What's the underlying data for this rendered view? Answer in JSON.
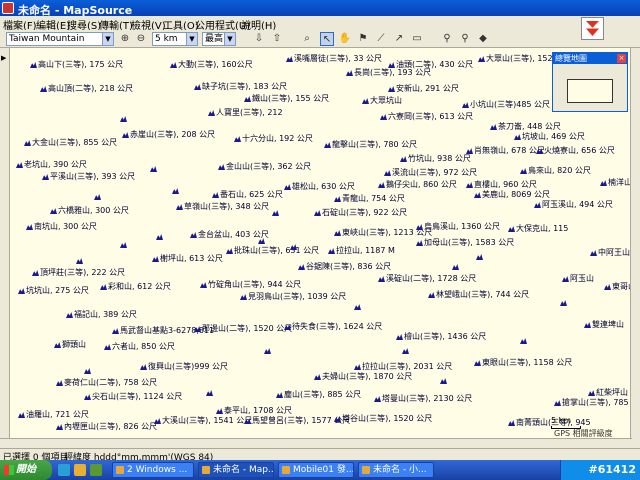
{
  "window": {
    "title": "未命名 - MapSource"
  },
  "menu": [
    "檔案(F)",
    "編輯(E)",
    "搜尋(S)",
    "傳輸(T)",
    "檢視(V)",
    "工具(O)",
    "公用程式(U)",
    "說明(H)"
  ],
  "toolbar": {
    "map_product": "Taiwan Mountain",
    "zoom_scale": "5 km",
    "detail_level": "最高"
  },
  "overview": {
    "title": "總覽地圖"
  },
  "scale": {
    "label": "5 km"
  },
  "gps_note": "GPS 相關評級度",
  "status": {
    "selection": "已選擇 0 個項目",
    "coord_format": "經緯度 hddd°mm.mmm'(WGS 84)"
  },
  "taskbar": {
    "start": "開始",
    "tasks": [
      "2 Windows ...",
      "未命名 - Map...",
      "Mobile01 發...",
      "未命名 - 小..."
    ],
    "clock": "#61412"
  },
  "peaks": [
    "高山下(三等), 175 公尺",
    "大動(三等), 160公尺",
    "溪嘴層徒(三等), 33 公尺",
    "油頭(二等), 430 公尺",
    "大眾山(三等), 152",
    "高山頂(二等), 218 公尺",
    "缺子坑(三等), 183 公尺",
    "長崗(三等), 193 公尺",
    "安新山, 291 公尺",
    "鐵山(三等), 155 公尺",
    "大眾坑山",
    "小坑山(三等)485 公尺",
    "人寶里(三等), 212",
    "六寮岡(三等), 613 公尺",
    "茶刀崙, 448 公尺",
    "赤崖山(三等), 208 公尺",
    "十六分山, 192 公尺",
    "坑坡山, 469 公尺",
    "大金山(三等), 855 公尺",
    "龍擊山(三等), 780 公尺",
    "肖無嶺山, 678 公尺",
    "火燒寮山, 656 公尺",
    "老坑山, 390 公尺",
    "金山山(三等), 362 公尺",
    "竹坑山, 938 公尺",
    "鳥來山, 820 公尺",
    "平溪山(三等), 393 公尺",
    "溪流山(三等), 972 公尺",
    "楠洋山",
    "雄松山, 630 公尺",
    "鵝仔尖山, 860 公尺",
    "直樓山, 960 公尺",
    "番石山, 625 公尺",
    "青龍山, 754 公尺",
    "美鹿山, 8069 公尺",
    "六橋雅山, 300 公尺",
    "草嶺山(三等), 348 公尺",
    "石碇山(三等), 922 公尺",
    "阿玉溪山, 494 公尺",
    "南坑山, 300 公尺",
    "金台盆山, 403 公尺",
    "東峽山(三等), 1213 公尺",
    "烏鳥溪山, 1360 公尺",
    "大保克山, 115",
    "拉拉山, 1187 M",
    "加母山(三等), 1583 公尺",
    "中阿王山",
    "批珠山(三等), 631 公尺",
    "榭坪山, 613 公尺",
    "谷鋸陳(三等), 836 公尺",
    "頂坪莊(三等), 222 公尺",
    "竹碇角山(三等), 944 公尺",
    "溪碇山(二等), 1728 公尺",
    "阿玉山",
    "坑坑山, 275 公尺",
    "彩和山, 612 公尺",
    "東哥山",
    "見羽鳥山(三等), 1039 公尺",
    "林望峨山(三等), 744 公尺",
    "福記山, 389 公尺",
    "馬武督山基點3-6278,811",
    "那邊山(二等), 1520 公尺",
    "待失食(三等), 1624 公尺",
    "雙連埤山",
    "獅頭山",
    "六者山, 850 公尺",
    "檜山(三等), 1436 公尺",
    "東眼山(三等), 1158 公尺",
    "復興山(三等)999 公尺",
    "麥荷仁山(二等), 758 公尺",
    "拉拉山(三等), 2031 公尺",
    "夫婦山(三等), 1870 公尺",
    "紅柴坪山",
    "尖石山(三等), 1124 公尺",
    "塵山(三等), 885 公尺",
    "塔曼山(三等), 2130 公尺",
    "搶掌山(三等), 785 公尺",
    "油羅山, 721 公尺",
    "泰平山, 1708 公尺",
    "內壢匣山(三等), 826 公尺",
    "大溪山(三等), 1541 公尺",
    "馬望曾呂(三等), 1577 公尺",
    "塔谷山(三等), 1520 公尺",
    "南菁頭山(三等), 945"
  ]
}
